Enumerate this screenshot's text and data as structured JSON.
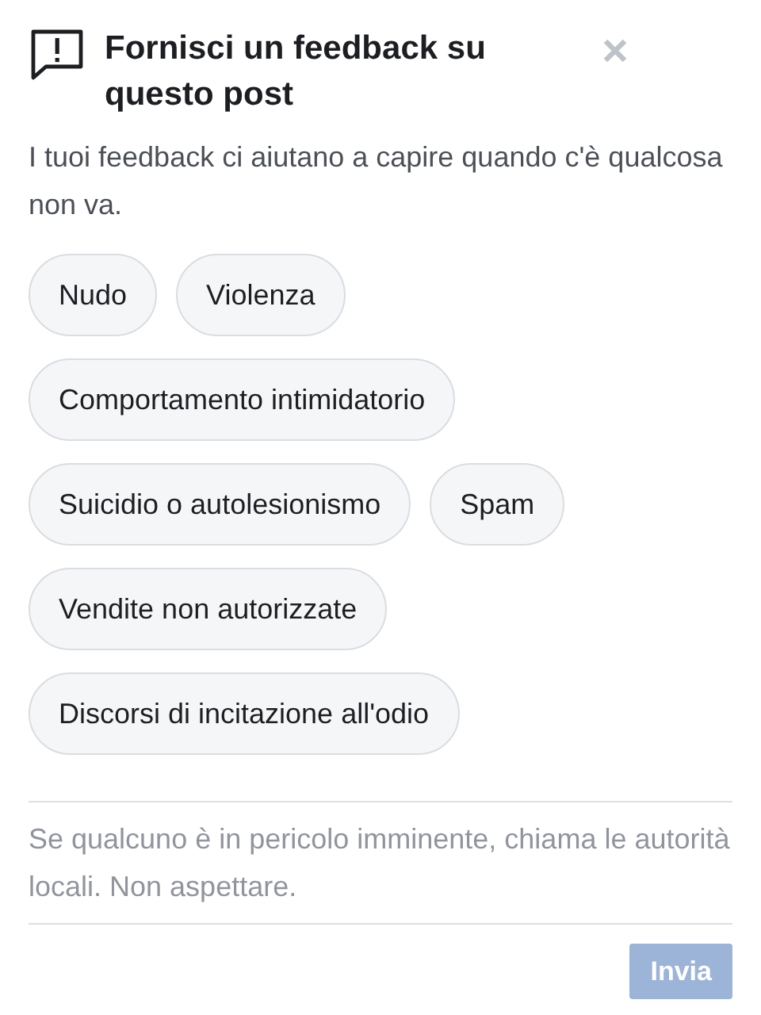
{
  "dialog": {
    "title": "Fornisci un feedback su questo post",
    "description": "I tuoi feedback ci aiutano a capire quando c'è qualcosa non va."
  },
  "option_rows": [
    [
      {
        "label": "Nudo",
        "selected": false
      },
      {
        "label": "Violenza",
        "selected": false
      }
    ],
    [
      {
        "label": "Comportamento intimidatorio",
        "selected": false
      }
    ],
    [
      {
        "label": "Suicidio o autolesionismo",
        "selected": false
      },
      {
        "label": "Spam",
        "selected": false
      }
    ],
    [
      {
        "label": "Vendite non autorizzate",
        "selected": false
      }
    ],
    [
      {
        "label": "Discorsi di incitazione all'odio",
        "selected": false
      }
    ]
  ],
  "notice": "Se qualcuno è in pericolo imminente, chiama le autorità locali. Non aspettare.",
  "submit": {
    "label": "Invia",
    "disabled": true
  }
}
